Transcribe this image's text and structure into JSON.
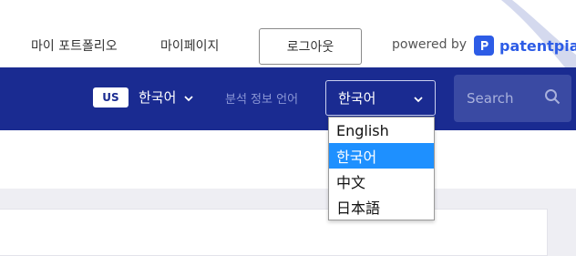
{
  "header": {
    "links": {
      "portfolio": "마이 포트폴리오",
      "mypage": "마이페이지"
    },
    "logout_label": "로그아웃",
    "powered_by": "powered by",
    "brand_name": "patentpia"
  },
  "navbar": {
    "region_badge": "US",
    "current_language": "한국어",
    "analysis_language_label": "분석 정보 언어",
    "analysis_language_select": {
      "value": "한국어",
      "options": [
        "English",
        "한국어",
        "中文",
        "日本語"
      ],
      "selected_index": 1
    },
    "search": {
      "placeholder": "Search"
    }
  },
  "colors": {
    "nav_background": "#1a2b91",
    "brand_blue": "#2d5ce6",
    "selected_option": "#1e90ff"
  },
  "icons": [
    "chevron-down-icon",
    "search-icon",
    "patentpia-logo-icon"
  ]
}
